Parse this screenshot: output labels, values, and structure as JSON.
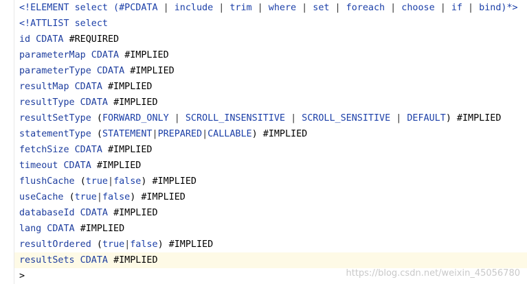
{
  "code": {
    "lines": [
      {
        "tokens": [
          [
            "<!ELEMENT select (#PCDATA ",
            "kw"
          ],
          [
            "|",
            "sep"
          ],
          [
            " include ",
            "kw"
          ],
          [
            "|",
            "sep"
          ],
          [
            " trim ",
            "kw"
          ],
          [
            "|",
            "sep"
          ],
          [
            " where ",
            "kw"
          ],
          [
            "|",
            "sep"
          ],
          [
            " set ",
            "kw"
          ],
          [
            "|",
            "sep"
          ],
          [
            " foreach ",
            "kw"
          ],
          [
            "|",
            "sep"
          ],
          [
            " choose ",
            "kw"
          ],
          [
            "|",
            "sep"
          ],
          [
            " if ",
            "kw"
          ],
          [
            "|",
            "sep"
          ],
          [
            " bind)*>",
            "kw"
          ]
        ]
      },
      {
        "tokens": [
          [
            "<!ATTLIST select",
            "kw"
          ]
        ]
      },
      {
        "tokens": [
          [
            "id CDATA ",
            "tx"
          ],
          [
            "#REQUIRED",
            "bl"
          ]
        ]
      },
      {
        "tokens": [
          [
            "parameterMap CDATA ",
            "tx"
          ],
          [
            "#IMPLIED",
            "bl"
          ]
        ]
      },
      {
        "tokens": [
          [
            "parameterType CDATA ",
            "tx"
          ],
          [
            "#IMPLIED",
            "bl"
          ]
        ]
      },
      {
        "tokens": [
          [
            "resultMap CDATA ",
            "tx"
          ],
          [
            "#IMPLIED",
            "bl"
          ]
        ]
      },
      {
        "tokens": [
          [
            "resultType CDATA ",
            "tx"
          ],
          [
            "#IMPLIED",
            "bl"
          ]
        ]
      },
      {
        "tokens": [
          [
            "resultSetType ",
            "tx"
          ],
          [
            "(",
            "bl"
          ],
          [
            "FORWARD_ONLY ",
            "kw"
          ],
          [
            "|",
            "sep"
          ],
          [
            " SCROLL_INSENSITIVE ",
            "kw"
          ],
          [
            "|",
            "sep"
          ],
          [
            " SCROLL_SENSITIVE ",
            "kw"
          ],
          [
            "|",
            "sep"
          ],
          [
            " DEFAULT",
            "kw"
          ],
          [
            ") #IMPLIED",
            "bl"
          ]
        ]
      },
      {
        "tokens": [
          [
            "statementType ",
            "tx"
          ],
          [
            "(",
            "bl"
          ],
          [
            "STATEMENT",
            "kw"
          ],
          [
            "|",
            "sep"
          ],
          [
            "PREPARED",
            "kw"
          ],
          [
            "|",
            "sep"
          ],
          [
            "CALLABLE",
            "kw"
          ],
          [
            ") #IMPLIED",
            "bl"
          ]
        ]
      },
      {
        "tokens": [
          [
            "fetchSize CDATA ",
            "tx"
          ],
          [
            "#IMPLIED",
            "bl"
          ]
        ]
      },
      {
        "tokens": [
          [
            "timeout CDATA ",
            "tx"
          ],
          [
            "#IMPLIED",
            "bl"
          ]
        ]
      },
      {
        "tokens": [
          [
            "flushCache ",
            "tx"
          ],
          [
            "(",
            "bl"
          ],
          [
            "true",
            "kw"
          ],
          [
            "|",
            "sep"
          ],
          [
            "false",
            "kw"
          ],
          [
            ") #IMPLIED",
            "bl"
          ]
        ]
      },
      {
        "tokens": [
          [
            "useCache ",
            "tx"
          ],
          [
            "(",
            "bl"
          ],
          [
            "true",
            "kw"
          ],
          [
            "|",
            "sep"
          ],
          [
            "false",
            "kw"
          ],
          [
            ") #IMPLIED",
            "bl"
          ]
        ]
      },
      {
        "tokens": [
          [
            "databaseId CDATA ",
            "tx"
          ],
          [
            "#IMPLIED",
            "bl"
          ]
        ]
      },
      {
        "tokens": [
          [
            "lang CDATA ",
            "tx"
          ],
          [
            "#IMPLIED",
            "bl"
          ]
        ]
      },
      {
        "tokens": [
          [
            "resultOrdered ",
            "tx"
          ],
          [
            "(",
            "bl"
          ],
          [
            "true",
            "kw"
          ],
          [
            "|",
            "sep"
          ],
          [
            "false",
            "kw"
          ],
          [
            ") #IMPLIED",
            "bl"
          ]
        ]
      },
      {
        "tokens": [
          [
            "resultSets CDATA ",
            "tx"
          ],
          [
            "#IMPLIED",
            "bl"
          ]
        ],
        "highlighted": true
      },
      {
        "tokens": [
          [
            ">",
            "bl"
          ]
        ]
      }
    ]
  },
  "watermark": "https://blog.csdn.net/weixin_45056780",
  "colors": {
    "keyword": "#1b3fa8",
    "text": "#1d3d9e",
    "plain": "#000000",
    "highlight": "#fefae6"
  }
}
